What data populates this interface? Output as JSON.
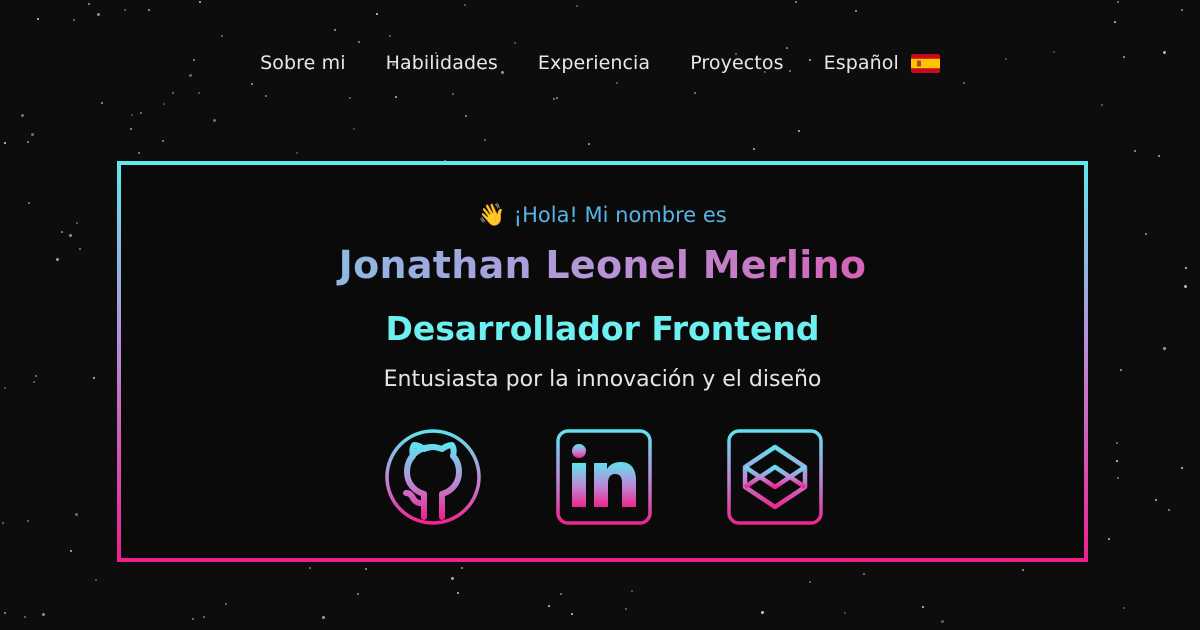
{
  "nav": {
    "items": [
      {
        "label": "Sobre mi"
      },
      {
        "label": "Habilidades"
      },
      {
        "label": "Experiencia"
      },
      {
        "label": "Proyectos"
      }
    ],
    "language": {
      "label": "Español",
      "flag_icon": "spain-flag-icon"
    }
  },
  "hero": {
    "greeting_emoji": "👋",
    "greeting": "¡Hola! Mi nombre es",
    "name": "Jonathan Leonel Merlino",
    "role": "Desarrollador Frontend",
    "tagline": "Entusiasta por la innovación y el diseño",
    "socials": [
      {
        "icon": "github-icon"
      },
      {
        "icon": "linkedin-icon"
      },
      {
        "icon": "codepen-icon"
      }
    ]
  },
  "colors": {
    "background": "#0d0d0e",
    "accent_cyan": "#5ee9ef",
    "accent_pink": "#ee1f8c",
    "greeting_blue": "#58b3e6",
    "role_cyan": "#6ff0f0"
  }
}
